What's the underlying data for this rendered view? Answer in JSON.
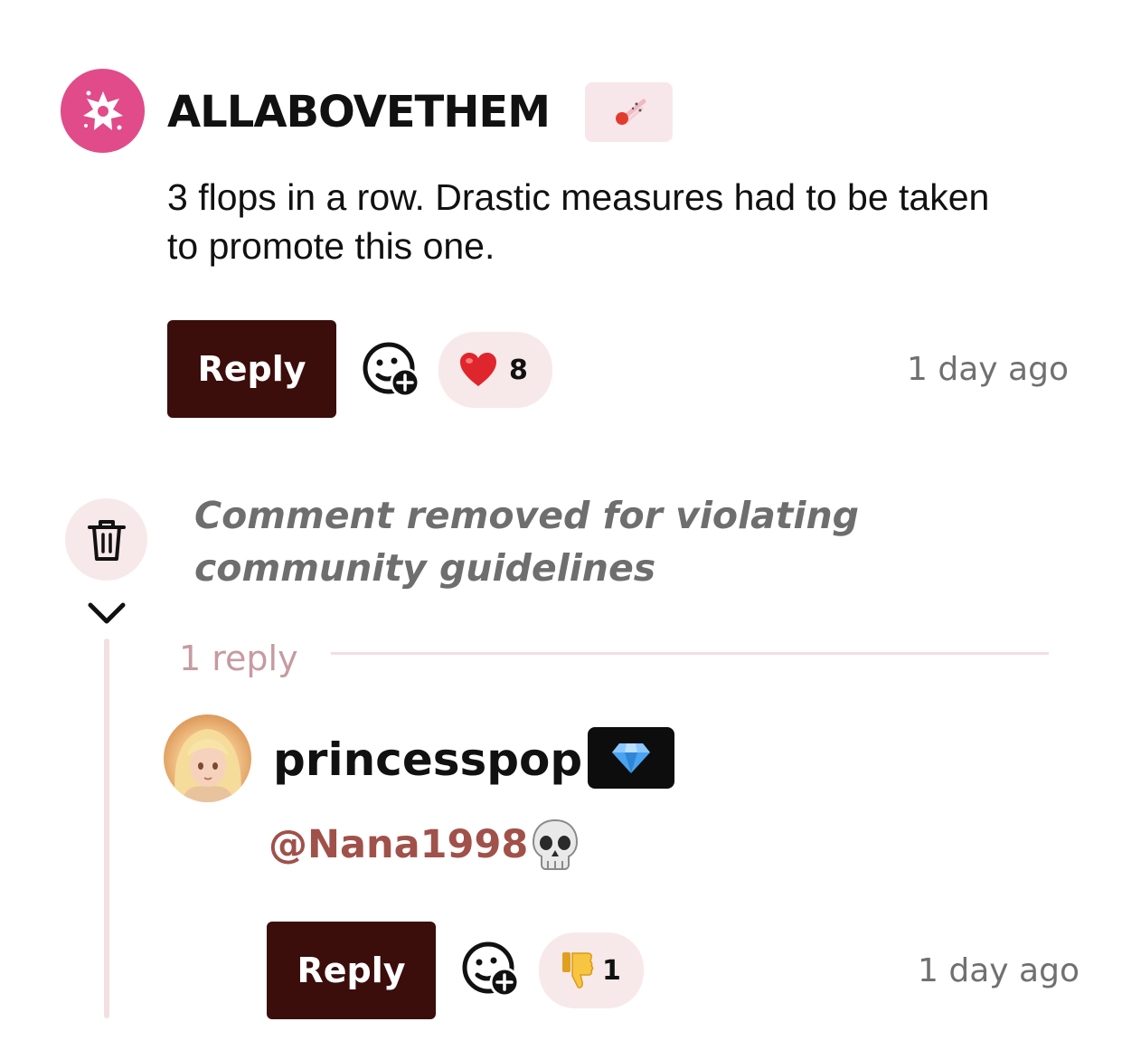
{
  "colors": {
    "reply_button_bg": "#3b0d0b",
    "reaction_pill_bg": "#f7e9ea",
    "mention": "#a0514a",
    "thread_line": "#f1dfe1",
    "avatar_pink": "#e14b8a"
  },
  "comment": {
    "avatar_icon": "starburst-icon",
    "username": "ALLABOVETHEM",
    "badge_icon": "meteor-icon",
    "text": "3 flops in a row. Drastic measures had to be taken to promote this one.",
    "reply_label": "Reply",
    "add_reaction_icon": "add-reaction-icon",
    "reaction": {
      "icon": "heart-icon",
      "emoji": "❤️",
      "count": "8"
    },
    "timestamp": "1 day ago"
  },
  "removed_comment": {
    "icon": "trash-icon",
    "text": "Comment removed for violating community guidelines",
    "collapse_icon": "chevron-down-icon",
    "replies_label": "1 reply"
  },
  "reply": {
    "avatar_icon": "anime-avatar",
    "username": "princesspop",
    "badge_icon": "diamond-icon",
    "mention": "@Nana1998",
    "emoji": "💀",
    "reply_label": "Reply",
    "add_reaction_icon": "add-reaction-icon",
    "reaction": {
      "icon": "thumbs-down-icon",
      "emoji": "👎",
      "count": "1"
    },
    "timestamp": "1 day ago"
  }
}
